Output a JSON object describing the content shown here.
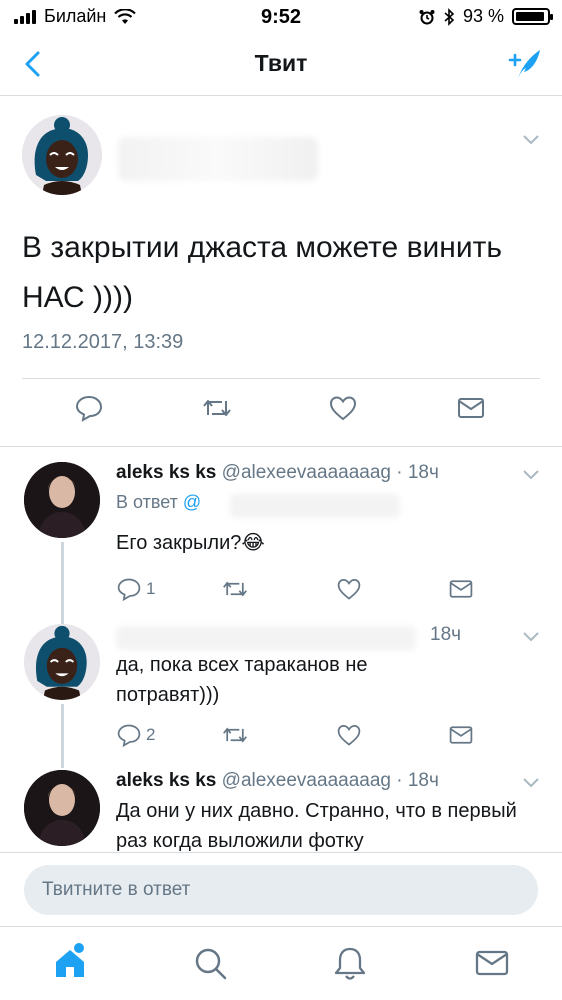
{
  "status": {
    "carrier": "Билайн",
    "time": "9:52",
    "battery": "93 %",
    "battery_level": 0.93
  },
  "nav": {
    "title": "Твит"
  },
  "main_tweet": {
    "text": "В закрытии джаста можете винить НАС ))))",
    "date": "12.12.2017, 13:39"
  },
  "replies": [
    {
      "name": "aleks ks ks",
      "handle": "@alexeevaaaaaaag",
      "time": "· 18ч",
      "in_reply_to": "В ответ ",
      "in_reply_at": "@",
      "text": "Его закрыли?",
      "emoji": "😂",
      "reply_count": "1"
    },
    {
      "time": "18ч",
      "text": "да, пока всех тараканов не потравят)))",
      "reply_count": "2"
    },
    {
      "name": "aleks ks ks",
      "handle": "@alexeevaaaaaaag",
      "time": "· 18ч",
      "text": "Да они у них давно. Странно, что в первый раз когда выложили фотку"
    }
  ],
  "reply_box": {
    "placeholder": "Твитните в ответ"
  },
  "colors": {
    "accent": "#1da1f2",
    "secondary": "#657786",
    "divider": "#d8dde1"
  },
  "icons": [
    "back-icon",
    "compose-icon",
    "reply-icon",
    "retweet-icon",
    "like-icon",
    "dm-icon",
    "home-icon",
    "search-icon",
    "notifications-icon",
    "messages-icon"
  ]
}
